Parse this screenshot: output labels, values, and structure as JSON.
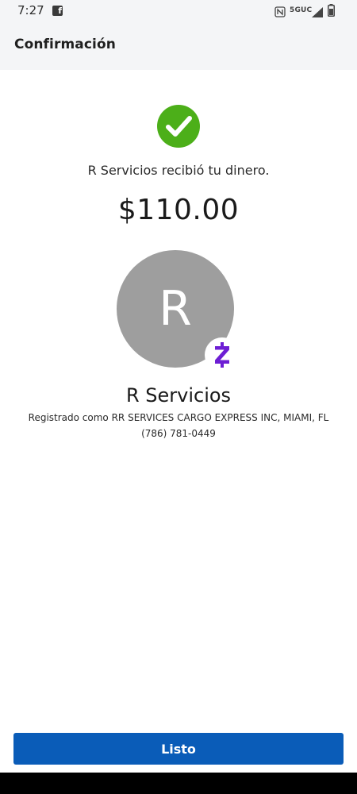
{
  "status_bar": {
    "time": "7:27",
    "notification_icon": "facebook-icon",
    "nfc_icon": "nfc-icon",
    "network": "5GUC",
    "signal_icon": "signal-icon",
    "battery_icon": "battery-icon"
  },
  "header": {
    "title": "Confirmación"
  },
  "confirmation": {
    "status_icon": "check-circle-icon",
    "status_color": "#4caf19",
    "message": "R Servicios recibió tu dinero.",
    "amount": "$110.00"
  },
  "recipient": {
    "avatar_initial": "R",
    "avatar_color": "#9e9e9e",
    "badge_icon": "zelle-icon",
    "badge_color": "#6d1ed4",
    "name": "R Servicios",
    "registered_as": "Registrado como RR SERVICES CARGO EXPRESS INC, MIAMI, FL",
    "phone": "(786) 781-0449"
  },
  "footer": {
    "done_label": "Listo",
    "accent": "#0a5cb8"
  }
}
